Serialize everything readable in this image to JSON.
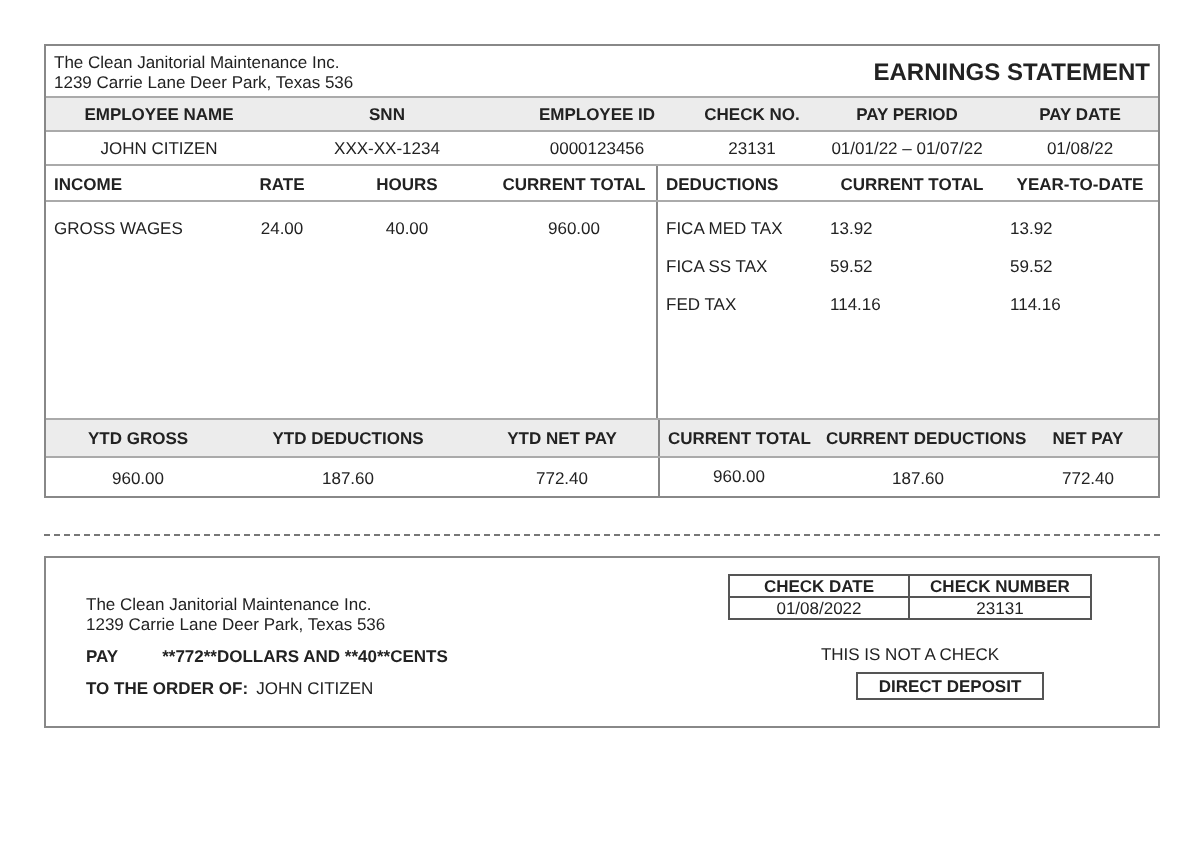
{
  "statement": {
    "company": {
      "name": "The Clean Janitorial Maintenance Inc.",
      "address": "1239 Carrie Lane Deer Park, Texas 536"
    },
    "title": "EARNINGS STATEMENT",
    "employee": {
      "columns": [
        "EMPLOYEE NAME",
        "SNN",
        "EMPLOYEE ID",
        "CHECK NO.",
        "PAY PERIOD",
        "PAY DATE"
      ],
      "values": [
        "JOHN CITIZEN",
        "XXX-XX-1234",
        "0000123456",
        "23131",
        "01/01/22 – 01/07/22",
        "01/08/22"
      ]
    },
    "income": {
      "columns": [
        "INCOME",
        "RATE",
        "HOURS",
        "CURRENT TOTAL"
      ],
      "rows": [
        [
          "GROSS WAGES",
          "24.00",
          "40.00",
          "960.00"
        ]
      ]
    },
    "deductions": {
      "columns": [
        "DEDUCTIONS",
        "CURRENT TOTAL",
        "YEAR-TO-DATE"
      ],
      "rows": [
        [
          "FICA MED TAX",
          "13.92",
          "13.92"
        ],
        [
          "FICA SS TAX",
          "59.52",
          "59.52"
        ],
        [
          "FED TAX",
          "114.16",
          "114.16"
        ]
      ]
    },
    "totals": {
      "columns": [
        "YTD GROSS",
        "YTD DEDUCTIONS",
        "YTD NET PAY",
        "CURRENT TOTAL",
        "CURRENT DEDUCTIONS",
        "NET PAY"
      ],
      "values": [
        "960.00",
        "187.60",
        "772.40",
        "960.00",
        "187.60",
        "772.40"
      ]
    }
  },
  "check": {
    "company": {
      "name": "The Clean Janitorial Maintenance Inc.",
      "address": "1239 Carrie Lane Deer Park, Texas 536"
    },
    "pay_label": "PAY",
    "pay_amount": "**772**DOLLARS AND **40**CENTS",
    "order_label": "TO THE ORDER OF:",
    "order_name": "JOHN CITIZEN",
    "info": {
      "columns": [
        "CHECK DATE",
        "CHECK NUMBER"
      ],
      "values": [
        "01/08/2022",
        "23131"
      ]
    },
    "notice": "THIS IS NOT A CHECK",
    "deposit": "DIRECT DEPOSIT"
  }
}
